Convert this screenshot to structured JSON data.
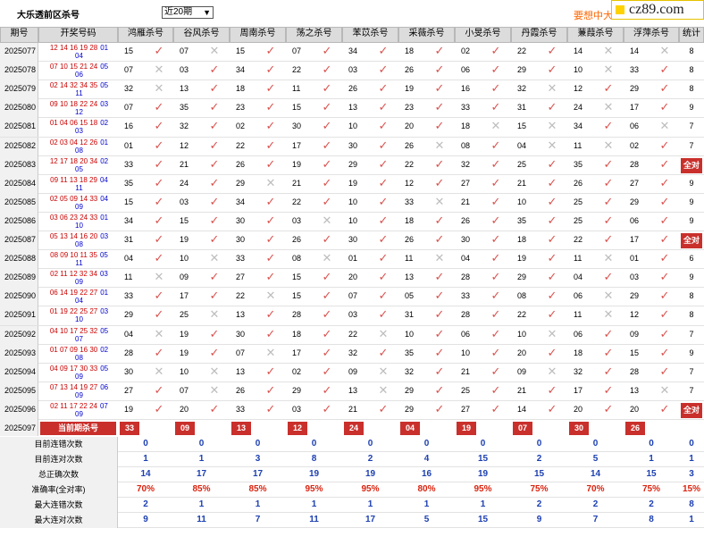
{
  "header": {
    "title": "大乐透前区杀号",
    "period_select": {
      "value": "近20期",
      "options": [
        "近20期"
      ]
    },
    "promo_text": "要想中大",
    "logo_text": "cz89.com"
  },
  "columns": {
    "period": "期号",
    "draw": "开奖号码",
    "experts": [
      "鸿雁杀号",
      "谷风杀号",
      "周南杀号",
      "荡之杀号",
      "苯苡杀号",
      "采薇杀号",
      "小旻杀号",
      "丹霞杀号",
      "蒹葭杀号",
      "浮萍杀号"
    ],
    "stat": "统计"
  },
  "rows": [
    {
      "period": "2025077",
      "front": "12 14 16 19 28",
      "back": [
        "01",
        "04"
      ],
      "kills": [
        "15",
        "07",
        "15",
        "07",
        "34",
        "18",
        "02",
        "22",
        "14",
        "14"
      ],
      "hits": [
        1,
        0,
        1,
        1,
        1,
        1,
        1,
        1,
        0,
        0
      ],
      "stat": "8"
    },
    {
      "period": "2025078",
      "front": "07 10 15 21 24",
      "back": [
        "05",
        "06"
      ],
      "kills": [
        "07",
        "03",
        "34",
        "22",
        "03",
        "26",
        "06",
        "29",
        "10",
        "33"
      ],
      "hits": [
        0,
        1,
        1,
        1,
        1,
        1,
        1,
        1,
        0,
        1
      ],
      "stat": "8"
    },
    {
      "period": "2025079",
      "front": "02 14 32 34 35",
      "back": [
        "05",
        "11"
      ],
      "kills": [
        "32",
        "13",
        "18",
        "11",
        "26",
        "19",
        "16",
        "32",
        "12",
        "29"
      ],
      "hits": [
        0,
        1,
        1,
        1,
        1,
        1,
        1,
        0,
        1,
        1
      ],
      "stat": "8"
    },
    {
      "period": "2025080",
      "front": "09 10 18 22 24",
      "back": [
        "03",
        "12"
      ],
      "kills": [
        "07",
        "35",
        "23",
        "15",
        "13",
        "23",
        "33",
        "31",
        "24",
        "17"
      ],
      "hits": [
        1,
        1,
        1,
        1,
        1,
        1,
        1,
        1,
        0,
        1
      ],
      "stat": "9"
    },
    {
      "period": "2025081",
      "front": "01 04 06 15 18",
      "back": [
        "02",
        "03"
      ],
      "kills": [
        "16",
        "32",
        "02",
        "30",
        "10",
        "20",
        "18",
        "15",
        "34",
        "06"
      ],
      "hits": [
        1,
        1,
        1,
        1,
        1,
        1,
        0,
        0,
        1,
        0
      ],
      "stat": "7"
    },
    {
      "period": "2025082",
      "front": "02 03 04 12 26",
      "back": [
        "01",
        "08"
      ],
      "kills": [
        "01",
        "12",
        "22",
        "17",
        "30",
        "26",
        "08",
        "04",
        "11",
        "02"
      ],
      "hits": [
        1,
        1,
        1,
        1,
        1,
        0,
        1,
        0,
        0,
        1
      ],
      "stat": "7"
    },
    {
      "period": "2025083",
      "front": "12 17 18 20 34",
      "back": [
        "02",
        "05"
      ],
      "kills": [
        "33",
        "21",
        "26",
        "19",
        "29",
        "22",
        "32",
        "25",
        "35",
        "28"
      ],
      "hits": [
        1,
        1,
        1,
        1,
        1,
        1,
        1,
        1,
        1,
        1
      ],
      "stat": "全对"
    },
    {
      "period": "2025084",
      "front": "09 11 13 18 29",
      "back": [
        "04",
        "11"
      ],
      "kills": [
        "35",
        "24",
        "29",
        "21",
        "19",
        "12",
        "27",
        "21",
        "26",
        "27"
      ],
      "hits": [
        1,
        1,
        0,
        1,
        1,
        1,
        1,
        1,
        1,
        1
      ],
      "stat": "9"
    },
    {
      "period": "2025085",
      "front": "02 05 09 14 33",
      "back": [
        "04",
        "09"
      ],
      "kills": [
        "15",
        "03",
        "34",
        "22",
        "10",
        "33",
        "21",
        "10",
        "25",
        "29"
      ],
      "hits": [
        1,
        1,
        1,
        1,
        1,
        0,
        1,
        1,
        1,
        1
      ],
      "stat": "9"
    },
    {
      "period": "2025086",
      "front": "03 06 23 24 33",
      "back": [
        "01",
        "10"
      ],
      "kills": [
        "34",
        "15",
        "30",
        "03",
        "10",
        "18",
        "26",
        "35",
        "25",
        "06"
      ],
      "hits": [
        1,
        1,
        1,
        0,
        1,
        1,
        1,
        1,
        1,
        1
      ],
      "stat": "9"
    },
    {
      "period": "2025087",
      "front": "05 13 14 16 20",
      "back": [
        "03",
        "08"
      ],
      "kills": [
        "31",
        "19",
        "30",
        "26",
        "30",
        "26",
        "30",
        "18",
        "22",
        "17"
      ],
      "hits": [
        1,
        1,
        1,
        1,
        1,
        1,
        1,
        1,
        1,
        1
      ],
      "stat": "全对"
    },
    {
      "period": "2025088",
      "front": "08 09 10 11 35",
      "back": [
        "05",
        "11"
      ],
      "kills": [
        "04",
        "10",
        "33",
        "08",
        "01",
        "11",
        "04",
        "19",
        "11",
        "01"
      ],
      "hits": [
        1,
        0,
        1,
        0,
        1,
        0,
        1,
        1,
        0,
        1
      ],
      "stat": "6"
    },
    {
      "period": "2025089",
      "front": "02 11 12 32 34",
      "back": [
        "03",
        "09"
      ],
      "kills": [
        "11",
        "09",
        "27",
        "15",
        "20",
        "13",
        "28",
        "29",
        "04",
        "03"
      ],
      "hits": [
        0,
        1,
        1,
        1,
        1,
        1,
        1,
        1,
        1,
        1
      ],
      "stat": "9"
    },
    {
      "period": "2025090",
      "front": "06 14 19 22 27",
      "back": [
        "01",
        "04"
      ],
      "kills": [
        "33",
        "17",
        "22",
        "15",
        "07",
        "05",
        "33",
        "08",
        "06",
        "29"
      ],
      "hits": [
        1,
        1,
        0,
        1,
        1,
        1,
        1,
        1,
        0,
        1
      ],
      "stat": "8"
    },
    {
      "period": "2025091",
      "front": "01 19 22 25 27",
      "back": [
        "03",
        "10"
      ],
      "kills": [
        "29",
        "25",
        "13",
        "28",
        "03",
        "31",
        "28",
        "22",
        "11",
        "12"
      ],
      "hits": [
        1,
        0,
        1,
        1,
        1,
        1,
        1,
        1,
        0,
        1
      ],
      "stat": "8"
    },
    {
      "period": "2025092",
      "front": "04 10 17 25 32",
      "back": [
        "05",
        "07"
      ],
      "kills": [
        "04",
        "19",
        "30",
        "18",
        "22",
        "10",
        "06",
        "10",
        "06",
        "09"
      ],
      "hits": [
        0,
        1,
        1,
        1,
        0,
        1,
        1,
        0,
        1,
        1
      ],
      "stat": "7"
    },
    {
      "period": "2025093",
      "front": "01 07 09 16 30",
      "back": [
        "02",
        "08"
      ],
      "kills": [
        "28",
        "19",
        "07",
        "17",
        "32",
        "35",
        "10",
        "20",
        "18",
        "15"
      ],
      "hits": [
        1,
        1,
        0,
        1,
        1,
        1,
        1,
        1,
        1,
        1
      ],
      "stat": "9"
    },
    {
      "period": "2025094",
      "front": "04 09 17 30 33",
      "back": [
        "05",
        "09"
      ],
      "kills": [
        "30",
        "10",
        "13",
        "02",
        "09",
        "32",
        "21",
        "09",
        "32",
        "28"
      ],
      "hits": [
        0,
        0,
        1,
        1,
        0,
        1,
        1,
        0,
        1,
        1
      ],
      "stat": "7"
    },
    {
      "period": "2025095",
      "front": "07 13 14 19 27",
      "back": [
        "06",
        "09"
      ],
      "kills": [
        "27",
        "07",
        "26",
        "29",
        "13",
        "29",
        "25",
        "21",
        "17",
        "13"
      ],
      "hits": [
        1,
        0,
        1,
        1,
        0,
        1,
        1,
        1,
        1,
        0
      ],
      "stat": "7"
    },
    {
      "period": "2025096",
      "front": "02 11 17 22 24",
      "back": [
        "07",
        "09"
      ],
      "kills": [
        "19",
        "20",
        "33",
        "03",
        "21",
        "29",
        "27",
        "14",
        "20",
        "20"
      ],
      "hits": [
        1,
        1,
        1,
        1,
        1,
        1,
        1,
        1,
        1,
        1
      ],
      "stat": "全对"
    }
  ],
  "current": {
    "period": "2025097",
    "label": "当前期杀号",
    "kills": [
      "33",
      "09",
      "13",
      "12",
      "24",
      "04",
      "19",
      "07",
      "30",
      "26"
    ]
  },
  "stats": [
    {
      "label": "目前连错次数",
      "values": [
        "0",
        "0",
        "0",
        "0",
        "0",
        "0",
        "0",
        "0",
        "0",
        "0",
        "0"
      ]
    },
    {
      "label": "目前连对次数",
      "values": [
        "1",
        "1",
        "3",
        "8",
        "2",
        "4",
        "15",
        "2",
        "5",
        "1",
        "1"
      ]
    },
    {
      "label": "总正确次数",
      "values": [
        "14",
        "17",
        "17",
        "19",
        "19",
        "16",
        "19",
        "15",
        "14",
        "15",
        "3"
      ]
    },
    {
      "label": "准确率(全对率)",
      "values": [
        "70%",
        "85%",
        "85%",
        "95%",
        "95%",
        "80%",
        "95%",
        "75%",
        "70%",
        "75%",
        "15%"
      ],
      "red": true
    },
    {
      "label": "最大连错次数",
      "values": [
        "2",
        "1",
        "1",
        "1",
        "1",
        "1",
        "1",
        "2",
        "2",
        "2",
        "8"
      ]
    },
    {
      "label": "最大连对次数",
      "values": [
        "9",
        "11",
        "7",
        "11",
        "17",
        "5",
        "15",
        "9",
        "7",
        "8",
        "1"
      ]
    }
  ],
  "icons": {
    "hit": "check-icon",
    "miss": "cross-icon"
  },
  "colors": {
    "hit": "#d9534f",
    "miss": "#bdbdbd",
    "accent": "#c9302c",
    "stat_value": "#1c3fb0",
    "header_bg": "#dcdcdc"
  }
}
